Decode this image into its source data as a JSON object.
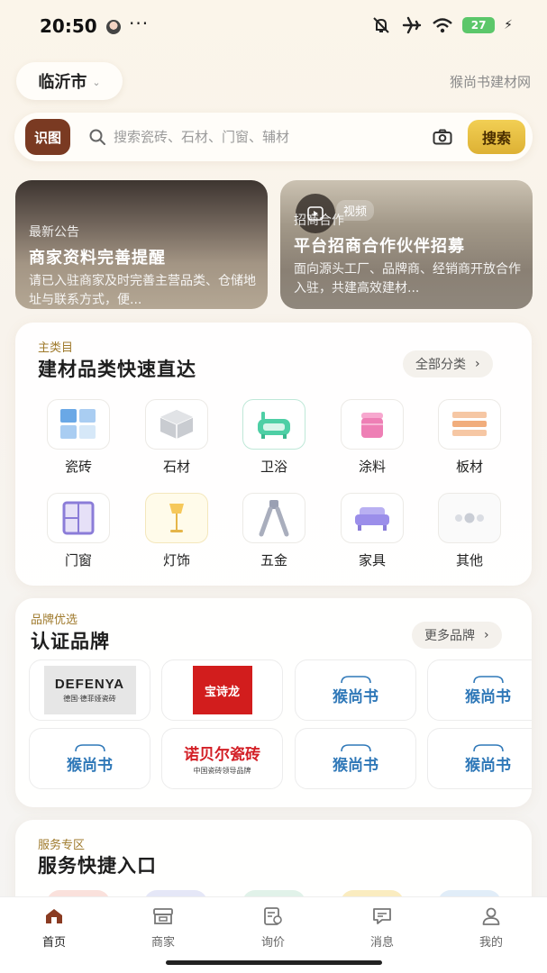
{
  "status_bar": {
    "time": "20:50",
    "more": "···",
    "battery": "27"
  },
  "header": {
    "city": "临沂市",
    "site_name": "猴尚书建材网"
  },
  "search": {
    "scan_label": "识图",
    "placeholder": "搜索瓷砖、石材、门窗、辅材",
    "button_label": "搜索"
  },
  "banners": [
    {
      "tag": "最新公告",
      "title": "商家资料完善提醒",
      "desc": "请已入驻商家及时完善主营品类、仓储地址与联系方式，便..."
    },
    {
      "tag": "招商合作",
      "video_label": "视频",
      "title": "平台招商合作伙伴招募",
      "desc": "面向源头工厂、品牌商、经销商开放合作入驻，共建高效建材..."
    }
  ],
  "categories": {
    "kicker": "主类目",
    "title": "建材品类快速直达",
    "more_label": "全部分类",
    "items": [
      {
        "label": "瓷砖",
        "icon": "tile-icon"
      },
      {
        "label": "石材",
        "icon": "stone-icon"
      },
      {
        "label": "卫浴",
        "icon": "bathtub-icon"
      },
      {
        "label": "涂料",
        "icon": "paint-bucket-icon"
      },
      {
        "label": "板材",
        "icon": "board-icon"
      },
      {
        "label": "门窗",
        "icon": "window-icon"
      },
      {
        "label": "灯饰",
        "icon": "lamp-icon"
      },
      {
        "label": "五金",
        "icon": "pliers-icon"
      },
      {
        "label": "家具",
        "icon": "sofa-icon"
      },
      {
        "label": "其他",
        "icon": "dots-icon"
      }
    ]
  },
  "brands": {
    "kicker": "品牌优选",
    "title": "认证品牌",
    "more_label": "更多品牌",
    "items": [
      {
        "name": "DEFENYA",
        "sub": "德国·德菲娅瓷砖"
      },
      {
        "name": "宝诗龙",
        "sub": ""
      },
      {
        "name": "猴尚书",
        "sub": ""
      },
      {
        "name": "猴尚书",
        "sub": ""
      },
      {
        "name": "猴尚书",
        "sub": ""
      },
      {
        "name": "诺贝尔瓷砖",
        "sub": "中国瓷砖领导品牌"
      },
      {
        "name": "猴尚书",
        "sub": ""
      },
      {
        "name": "猴尚书",
        "sub": ""
      }
    ]
  },
  "services": {
    "kicker": "服务专区",
    "title": "服务快捷入口"
  },
  "bottom_nav": [
    {
      "label": "首页",
      "icon": "home-icon",
      "active": true
    },
    {
      "label": "商家",
      "icon": "store-icon",
      "active": false
    },
    {
      "label": "询价",
      "icon": "inquiry-icon",
      "active": false
    },
    {
      "label": "消息",
      "icon": "message-icon",
      "active": false
    },
    {
      "label": "我的",
      "icon": "profile-icon",
      "active": false
    }
  ],
  "colors": {
    "accent_brown": "#7a3a22",
    "accent_gold": "#ddb134",
    "kicker": "#9f7a2c"
  }
}
